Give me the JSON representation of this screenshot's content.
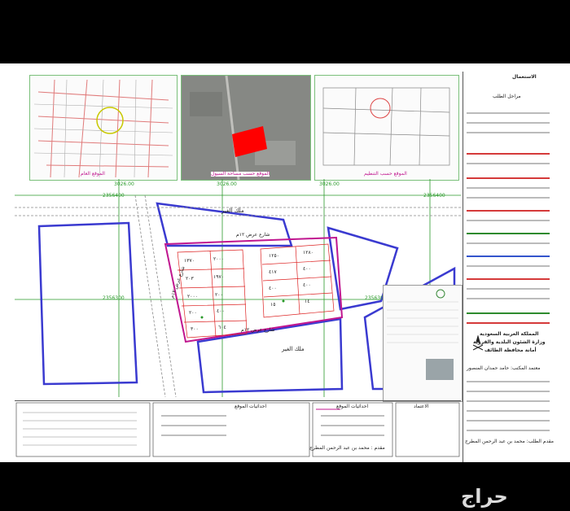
{
  "thumbs": {
    "general": "الموقع العام",
    "satellite": "الموقع حسب مساحة السيول",
    "plan": "الموقع حسب التنظيم"
  },
  "streets": {
    "malik_top": "ملك الغير",
    "malik_bottom": "ملك الغير",
    "st_top": "شارع عرض ١٢م",
    "st_side": "شارع عرض ١٢م",
    "st_bottom": "شارع عرض ١٢م"
  },
  "grid_labels": {
    "t1": "2356400",
    "t2": "2356400",
    "m1": "2356300",
    "m2": "2356300",
    "left_v": "3026.00",
    "mid_v": "3026.00",
    "right_v": "3026.00"
  },
  "plots_left": [
    "١٣٧٠",
    "٢٠٠٠",
    "٢٠٣",
    "١٩٧٠",
    "٢٠٠٠",
    "٢٠٠",
    "٢٠٠",
    "٤٠٠",
    "٣٠٠",
    "٦٠٤"
  ],
  "plots_right": [
    "١٢٥٠",
    "١٢٨٠",
    "٤١٧",
    "٤٠٠",
    "٤٠٠",
    "٤٠٠",
    "١٥",
    "١٤"
  ],
  "sidebar": {
    "title1": "الاستعمال",
    "title2": "مراحل الطلب",
    "authority1": "المملكة العربية السعودية",
    "authority2": "وزارة الشئون البلدية والقروية",
    "authority3": "أمانة محافظة الطائف",
    "owner": "مقدم الطلب: محمد بن عبد الرحمن المطرج",
    "office": "معتمد المكتب: حامد حمدان المنصور"
  },
  "footer": {
    "site_box": "احداثيات الموقع",
    "approval": "الاعتماد",
    "site_calc": "احداثيات الموقع",
    "bottom_name": "مقدم : محمد بن عبد الرحمن المطرج"
  },
  "watermark": "حراج",
  "colors": {
    "street_magenta": "#c0168f",
    "grid_green": "#2a9a2a",
    "plot_red": "#ff0000"
  }
}
